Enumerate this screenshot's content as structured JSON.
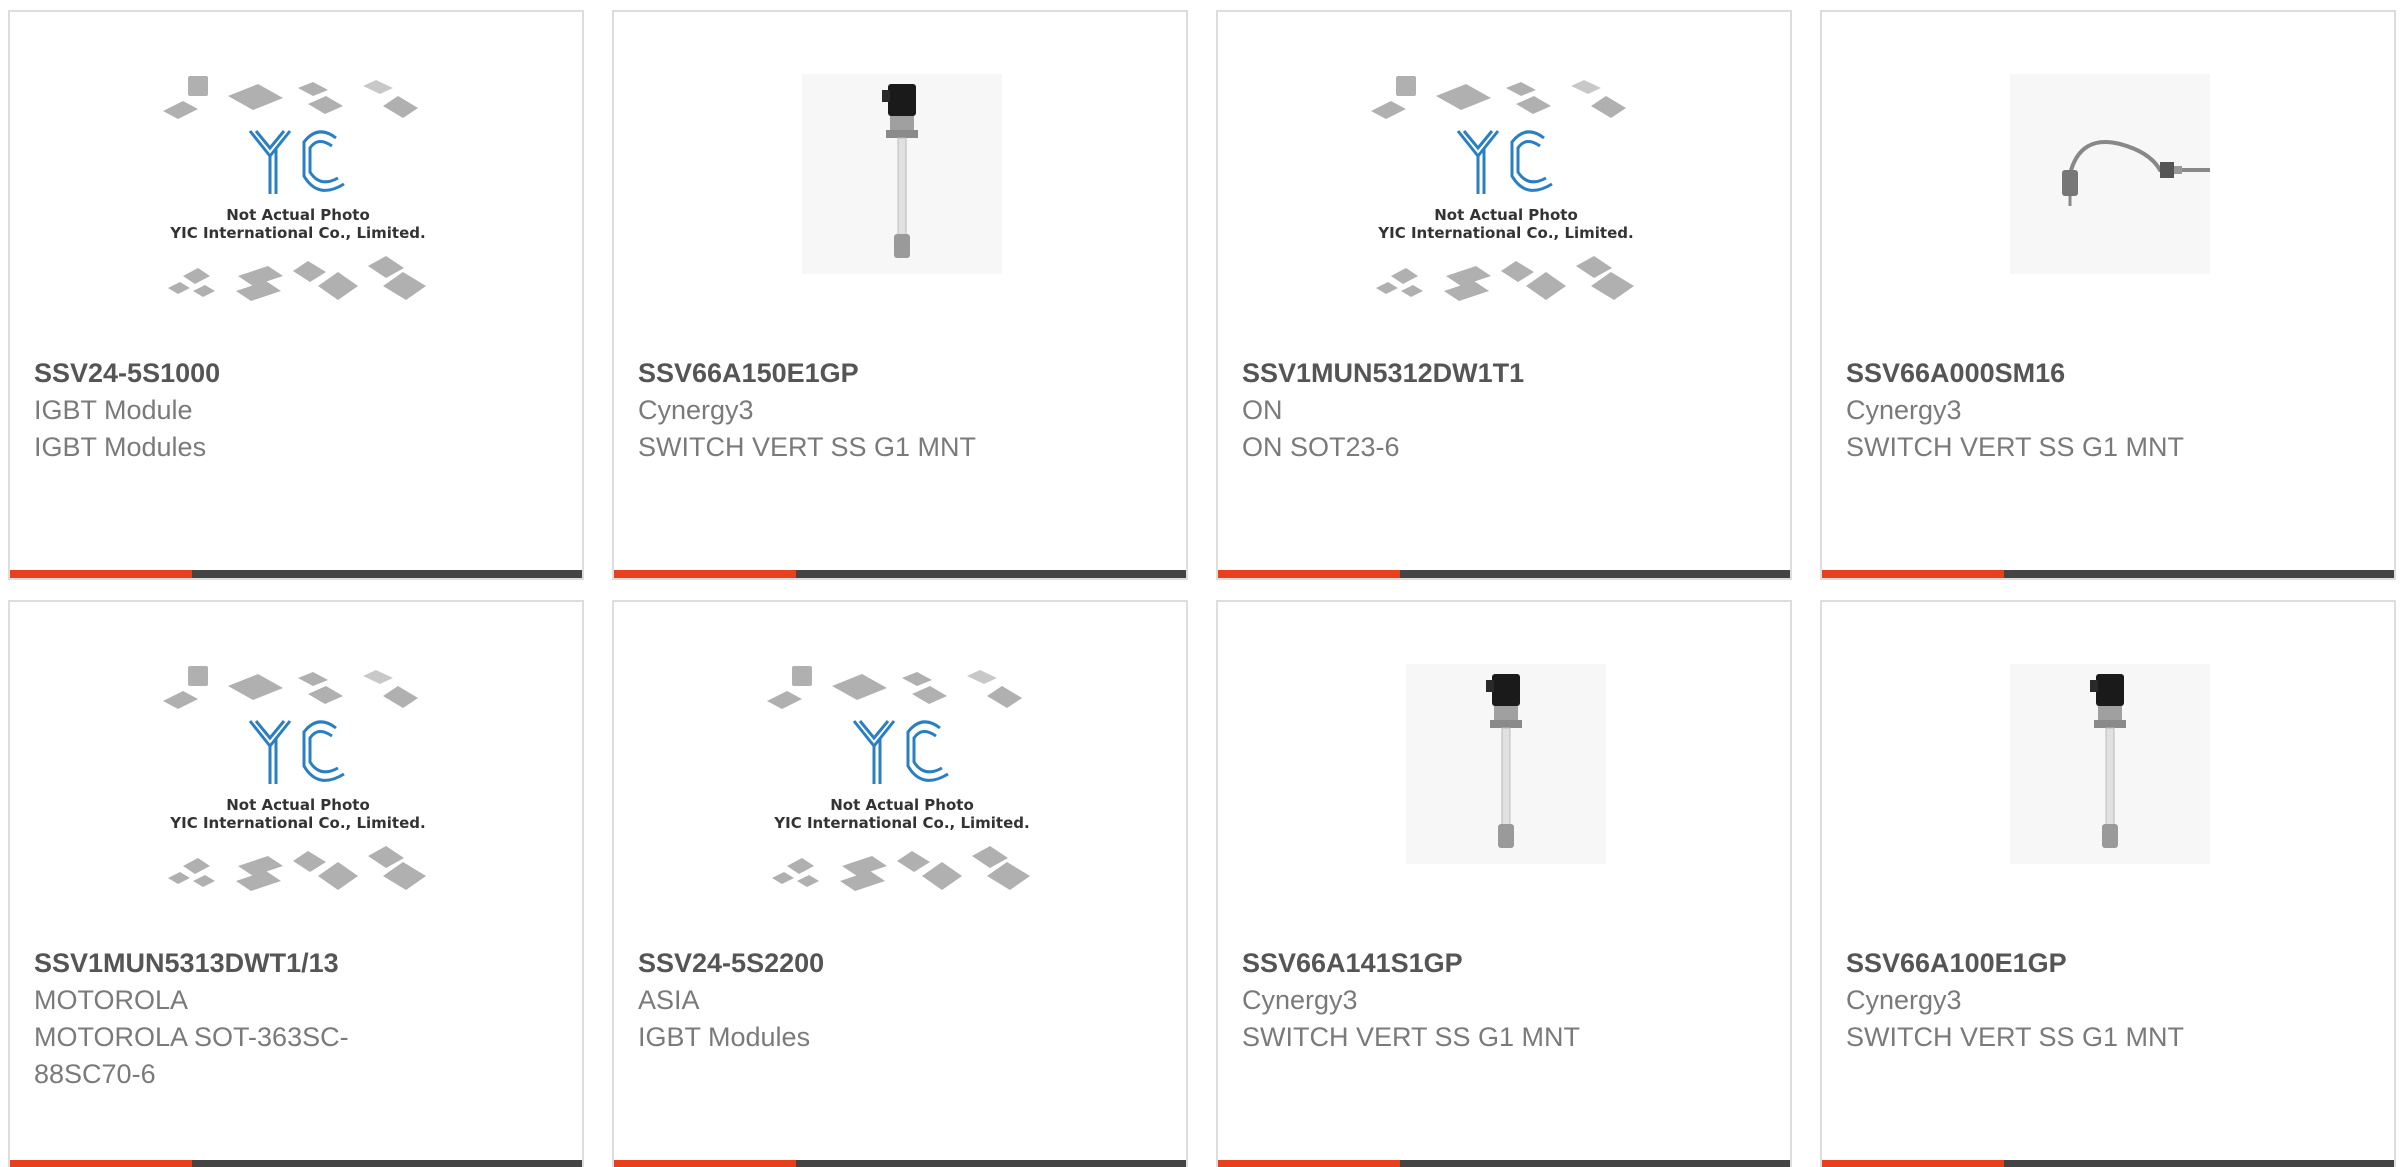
{
  "products": [
    {
      "part": "SSV24-5S1000",
      "maker": "IGBT Module",
      "desc": "IGBT Modules",
      "image": "yic-placeholder"
    },
    {
      "part": "SSV66A150E1GP",
      "maker": "Cynergy3",
      "desc": "SWITCH VERT SS G1 MNT",
      "image": "vertical-float-switch"
    },
    {
      "part": "SSV1MUN5312DW1T1",
      "maker": "ON",
      "desc": "ON SOT23-6",
      "image": "yic-placeholder"
    },
    {
      "part": "SSV66A000SM16",
      "maker": "Cynergy3",
      "desc": "SWITCH VERT SS G1 MNT",
      "image": "bent-float-switch"
    },
    {
      "part": "SSV1MUN5313DWT1/13",
      "maker": "MOTOROLA",
      "desc": "MOTOROLA SOT-363SC-88SC70-6",
      "image": "yic-placeholder"
    },
    {
      "part": "SSV24-5S2200",
      "maker": "ASIA",
      "desc": "IGBT Modules",
      "image": "yic-placeholder"
    },
    {
      "part": "SSV66A141S1GP",
      "maker": "Cynergy3",
      "desc": "SWITCH VERT SS G1 MNT",
      "image": "vertical-float-switch"
    },
    {
      "part": "SSV66A100E1GP",
      "maker": "Cynergy3",
      "desc": "SWITCH VERT SS G1 MNT",
      "image": "vertical-float-switch"
    }
  ],
  "placeholder": {
    "line1": "Not Actual Photo",
    "line2": "YIC International Co., Limited.",
    "logo_text": "YIC"
  },
  "colors": {
    "accent": "#e8401c",
    "bar": "#444444",
    "border": "#dddddd",
    "logo": "#2a7fc4"
  }
}
